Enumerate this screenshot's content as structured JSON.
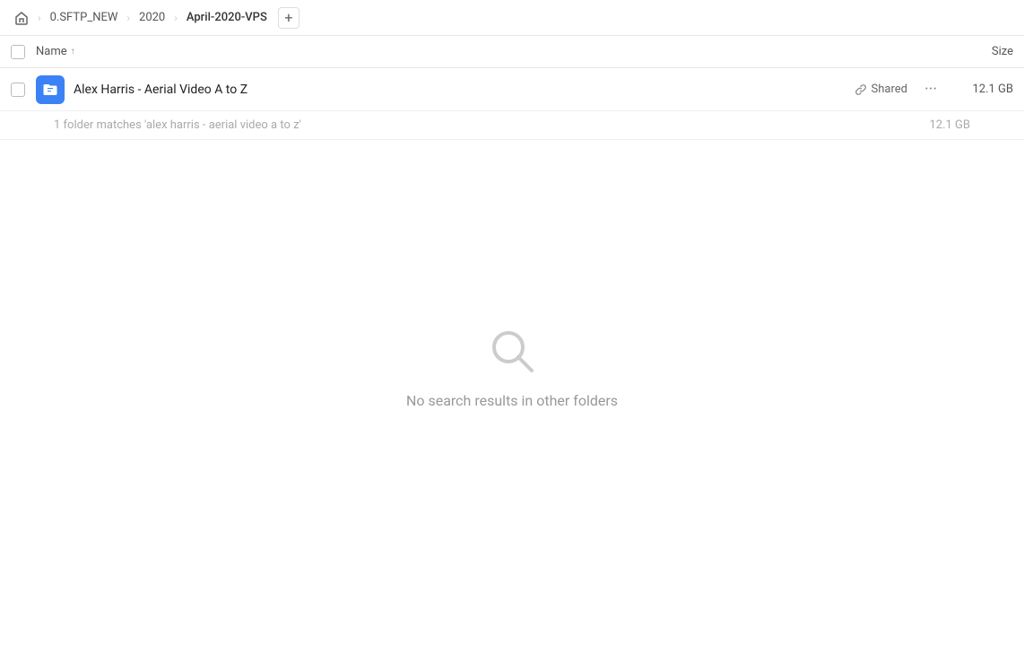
{
  "breadcrumb": {
    "home_icon": "home",
    "items": [
      {
        "label": "0.SFTP_NEW",
        "active": false
      },
      {
        "label": "2020",
        "active": false
      },
      {
        "label": "April-2020-VPS",
        "active": true
      }
    ],
    "add_tab_label": "+"
  },
  "column_header": {
    "name_label": "Name",
    "sort_arrow": "↑",
    "size_label": "Size"
  },
  "file_row": {
    "name": "Alex Harris - Aerial Video A to Z",
    "shared_label": "Shared",
    "size": "12.1 GB",
    "more_icon": "···"
  },
  "match_info": {
    "text": "1 folder matches 'alex harris - aerial video a to z'",
    "size": "12.1 GB"
  },
  "empty_state": {
    "icon": "search",
    "text": "No search results in other folders"
  }
}
